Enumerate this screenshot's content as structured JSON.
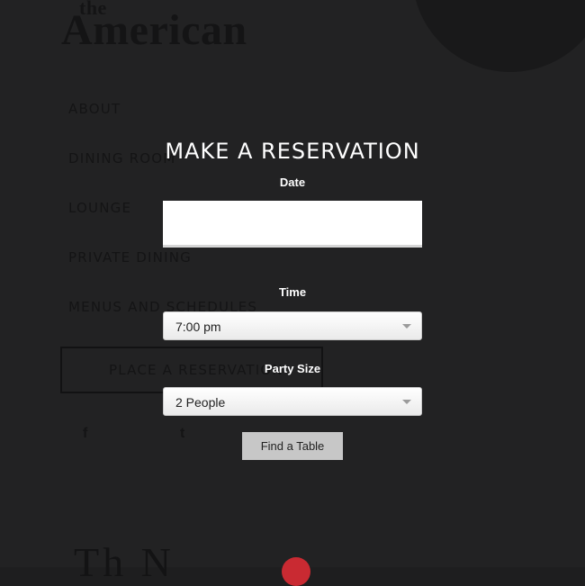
{
  "background": {
    "logo_line1": "the",
    "logo_line2": "American",
    "nav": [
      "ABOUT",
      "DINING ROOM",
      "LOUNGE",
      "PRIVATE DINING",
      "MENUS AND SCHEDULES"
    ],
    "reserve_button": "PLACE A RESERVATION",
    "social": {
      "facebook": "f",
      "twitter": "t"
    },
    "bottom_logo": "Th     N"
  },
  "modal": {
    "title": "MAKE A RESERVATION",
    "date": {
      "label": "Date",
      "value": ""
    },
    "time": {
      "label": "Time",
      "value": "7:00 pm"
    },
    "party": {
      "label": "Party Size",
      "value": "2 People"
    },
    "submit": "Find a Table"
  },
  "colors": {
    "accent_dot": "#c92a32",
    "overlay_bg": "#222223"
  }
}
